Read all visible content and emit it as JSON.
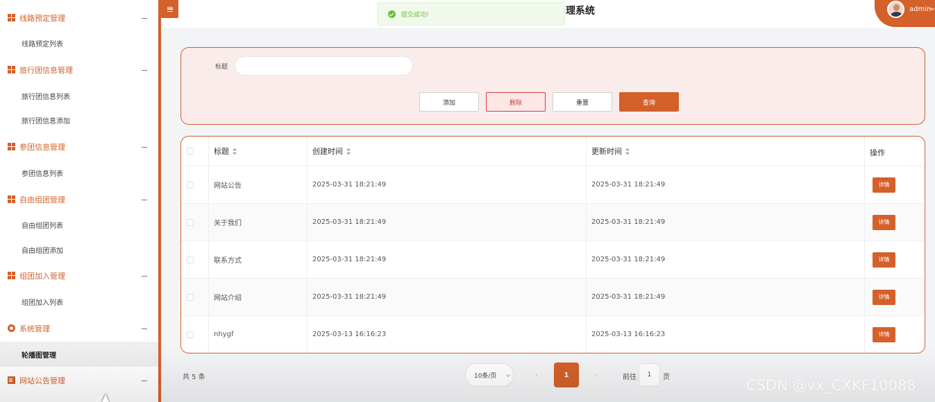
{
  "sidebar": {
    "groups": [
      {
        "label": "线路预定管理",
        "icon": "grid-icon",
        "children": [
          "线路预定列表"
        ]
      },
      {
        "label": "旅行团信息管理",
        "icon": "grid-icon",
        "children": [
          "旅行团信息列表",
          "旅行团信息添加"
        ]
      },
      {
        "label": "参团信息管理",
        "icon": "grid-icon",
        "children": [
          "参团信息列表"
        ]
      },
      {
        "label": "自由组团管理",
        "icon": "grid-icon",
        "children": [
          "自由组团列表",
          "自由组团添加"
        ]
      },
      {
        "label": "组团加入管理",
        "icon": "grid-icon",
        "children": [
          "组团加入列表"
        ]
      },
      {
        "label": "系统管理",
        "icon": "gear-icon",
        "children": [
          "轮播图管理"
        ]
      },
      {
        "label": "网站公告管理",
        "icon": "document-icon",
        "children": []
      }
    ],
    "active_item": "轮播图管理"
  },
  "header": {
    "title_fragment": "理系统",
    "user": "admin",
    "toast": "提交成功!"
  },
  "search": {
    "label": "标题",
    "value": "",
    "buttons": {
      "add": "添加",
      "delete": "删除",
      "reset": "重置",
      "search": "查询"
    }
  },
  "table": {
    "columns": [
      "标题",
      "创建时间",
      "更新时间",
      "操作"
    ],
    "rows": [
      {
        "title": "网站公告",
        "created": "2025-03-31 18:21:49",
        "updated": "2025-03-31 18:21:49",
        "action": "详情"
      },
      {
        "title": "关于我们",
        "created": "2025-03-31 18:21:49",
        "updated": "2025-03-31 18:21:49",
        "action": "详情"
      },
      {
        "title": "联系方式",
        "created": "2025-03-31 18:21:49",
        "updated": "2025-03-31 18:21:49",
        "action": "详情"
      },
      {
        "title": "网站介绍",
        "created": "2025-03-31 18:21:49",
        "updated": "2025-03-31 18:21:49",
        "action": "详情"
      },
      {
        "title": "nhygf",
        "created": "2025-03-13 16:16:23",
        "updated": "2025-03-13 16:16:23",
        "action": "详情"
      }
    ]
  },
  "pagination": {
    "total": "共 5 条",
    "page_size": "10条/页",
    "current_page": "1",
    "goto_label": "前往",
    "goto_value": "1",
    "goto_unit": "页"
  },
  "watermark": "CSDN @vx_CXKF10088",
  "colors": {
    "accent": "#d4602a",
    "danger": "#d43f3f",
    "success": "#67c23a"
  }
}
